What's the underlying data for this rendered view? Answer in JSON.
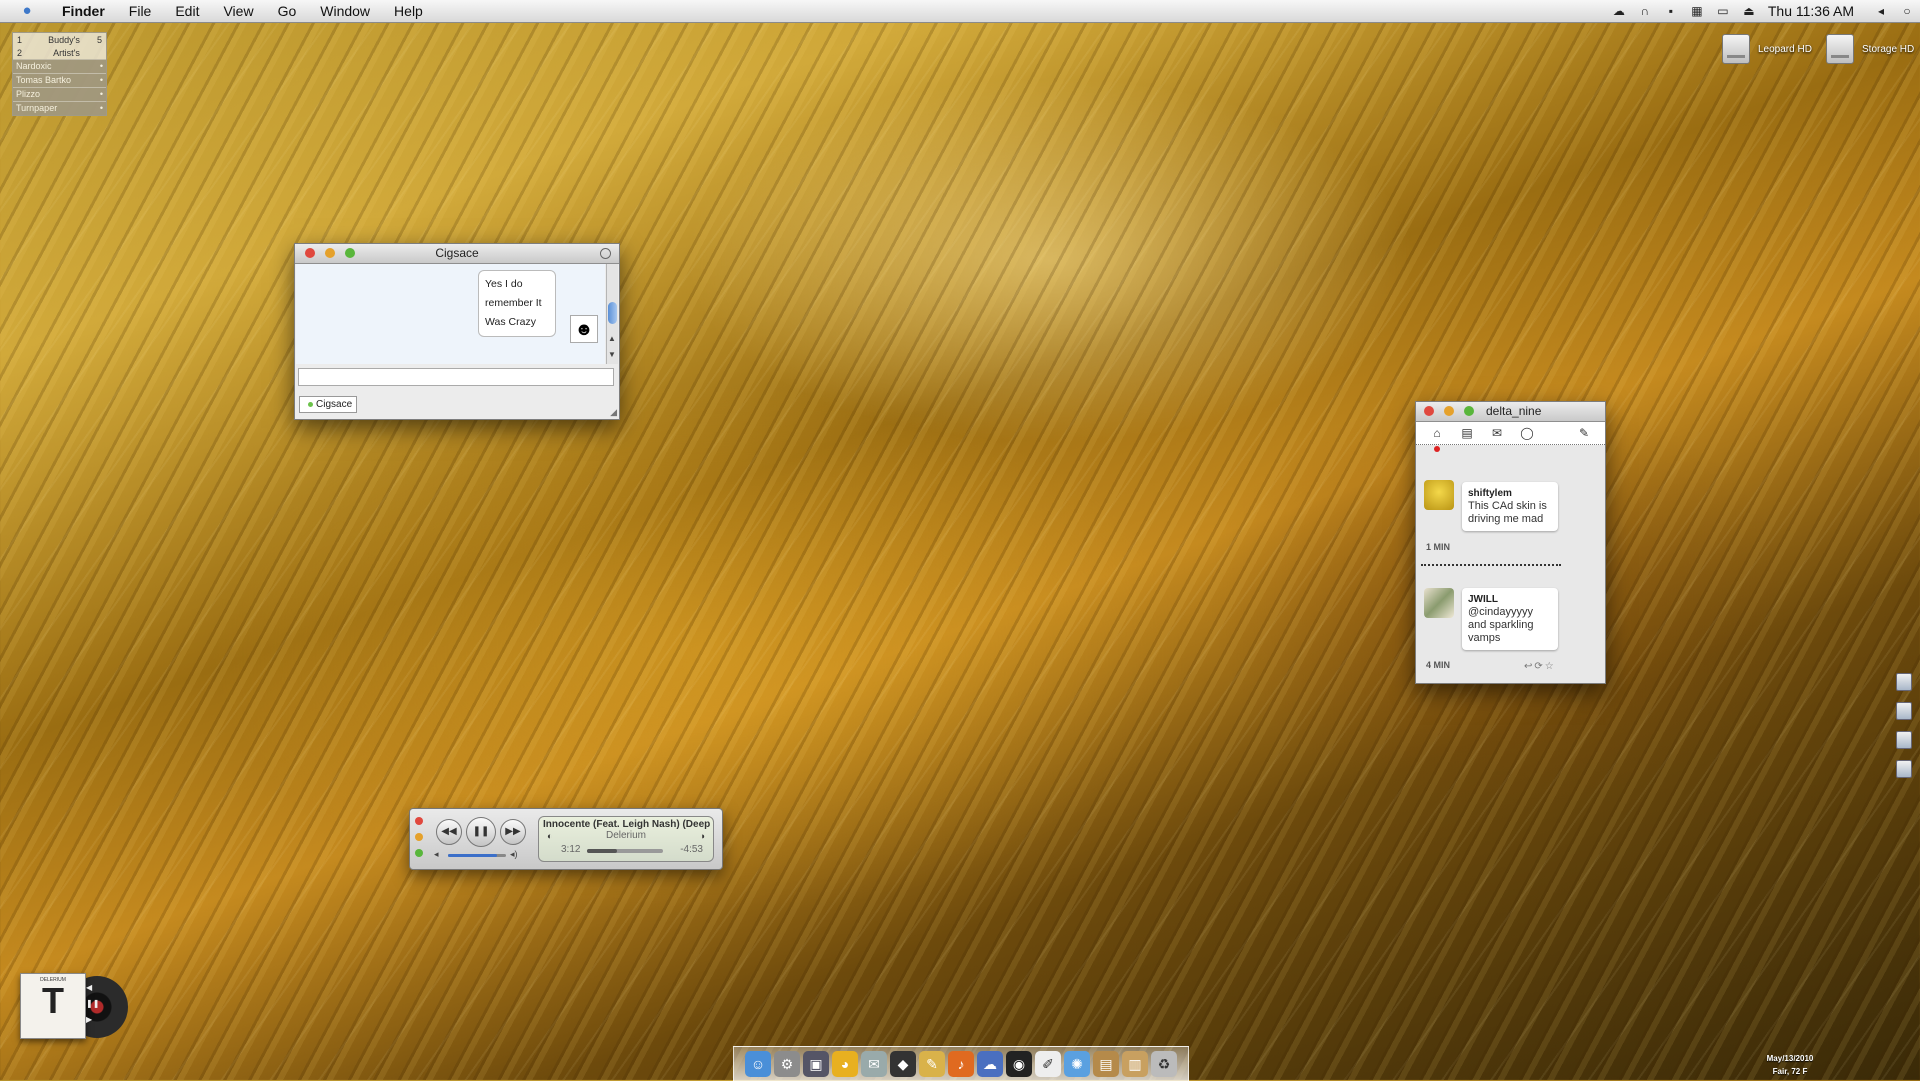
{
  "menubar": {
    "app_name": "Finder",
    "menus": [
      "File",
      "Edit",
      "View",
      "Go",
      "Window",
      "Help"
    ],
    "clock": "Thu 11:36 AM"
  },
  "buddy_widget": {
    "rows": [
      {
        "num": "1",
        "name": "Buddy's",
        "count": "5"
      },
      {
        "num": "2",
        "name": "Artist's",
        "count": ""
      }
    ],
    "items": [
      "Nardoxic",
      "Tomas Bartko",
      "Plizzo",
      "Turnpaper"
    ]
  },
  "drives": [
    "Leopard HD",
    "Storage HD"
  ],
  "chat_window": {
    "title": "Cigsace",
    "message": "Yes I do remember It Was Crazy",
    "tab_label": "Cigsace"
  },
  "twitter_window": {
    "title": "delta_nine",
    "tweets": [
      {
        "user": "shiftylem",
        "text": "This CAd skin is driving me mad",
        "age": "1 MIN"
      },
      {
        "user": "JWILL",
        "text": "@cindayyyyy and sparkling vamps",
        "age": "4 MIN"
      }
    ]
  },
  "itunes_mini": {
    "song": "Innocente (Feat. Leigh Nash) (Deep",
    "artist": "Delerium",
    "elapsed": "3:12",
    "remaining": "-4:53",
    "progress": 0.4,
    "volume": 0.85
  },
  "album": {
    "artist": "DELERIUM",
    "letter": "T"
  },
  "dock": {
    "icons": [
      "finder-icon",
      "system-prefs-icon",
      "preview-icon",
      "adium-icon",
      "mail-icon",
      "cyberduck-icon",
      "pencil-icon",
      "itunes-icon",
      "ichat-icon",
      "dashboard-icon",
      "textedit-icon",
      "safari-icon",
      "downloads-stack-icon",
      "documents-stack-icon",
      "trash-icon"
    ]
  },
  "weather": {
    "date": "May/13/2010",
    "conditions": "Fair, 72 F"
  }
}
